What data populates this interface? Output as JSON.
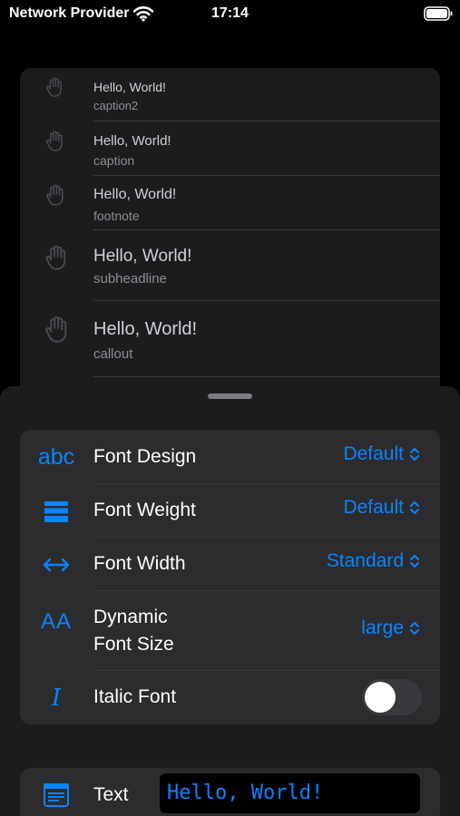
{
  "status_bar": {
    "carrier": "Network Provider",
    "time": "17:14",
    "wifi_icon": "wifi-icon",
    "battery_icon": "battery-icon"
  },
  "preview_list": [
    {
      "title": "Hello, World!",
      "style": "caption2"
    },
    {
      "title": "Hello, World!",
      "style": "caption"
    },
    {
      "title": "Hello, World!",
      "style": "footnote"
    },
    {
      "title": "Hello, World!",
      "style": "subheadline"
    },
    {
      "title": "Hello, World!",
      "style": "callout"
    }
  ],
  "settings": {
    "font_design": {
      "icon": "abc",
      "label": "Font Design",
      "value": "Default"
    },
    "font_weight": {
      "icon": "font-weight-icon",
      "label": "Font Weight",
      "value": "Default"
    },
    "font_width": {
      "icon": "font-width-icon",
      "label": "Font Width",
      "value": "Standard"
    },
    "dynamic_size": {
      "icon": "AA",
      "label_line1": "Dynamic",
      "label_line2": "Font Size",
      "value": "large"
    },
    "italic": {
      "icon": "I",
      "label": "Italic Font",
      "on": false
    }
  },
  "text_row": {
    "icon": "text-document-icon",
    "label": "Text",
    "value": "Hello, World!"
  },
  "colors": {
    "accent": "#0a84ff",
    "sheet": "#1c1c1e",
    "group": "#2c2c2e"
  }
}
